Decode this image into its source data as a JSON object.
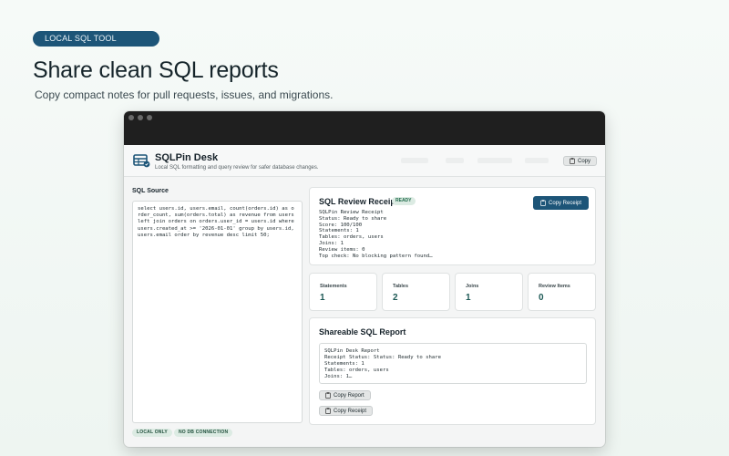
{
  "hero": {
    "tag": "LOCAL SQL TOOL",
    "title": "Share clean SQL reports",
    "subtitle": "Copy compact notes for pull requests, issues, and migrations."
  },
  "app": {
    "name": "SQLPin Desk",
    "tagline": "Local SQL formatting and query review for safer database changes.",
    "copy_label": "Copy"
  },
  "sql_source": {
    "label": "SQL Source",
    "value": "select users.id, users.email, count(orders.id) as order_count, sum(orders.total) as revenue from users left join orders on orders.user_id = users.id where users.created_at >= '2026-01-01' group by users.id, users.email order by revenue desc limit 50;"
  },
  "footer_badges": [
    "LOCAL ONLY",
    "NO DB CONNECTION"
  ],
  "receipt": {
    "title": "SQL Review Receipt",
    "status_badge": "READY",
    "copy_label": "Copy Receipt",
    "lines": [
      "SQLPin Review Receipt",
      "Status: Ready to share",
      "Score: 100/100",
      "Statements: 1",
      "Tables: orders, users",
      "Joins: 1",
      "Review items: 0",
      "Top check: No blocking pattern found…"
    ]
  },
  "stats": [
    {
      "label": "Statements",
      "value": "1"
    },
    {
      "label": "Tables",
      "value": "2"
    },
    {
      "label": "Joins",
      "value": "1"
    },
    {
      "label": "Review Items",
      "value": "0"
    }
  ],
  "report": {
    "title": "Shareable SQL Report",
    "lines": [
      "SQLPin Desk Report",
      "Receipt Status: Status: Ready to share",
      "Statements: 1",
      "Tables: orders, users",
      "Joins: 1…"
    ],
    "copy_report_label": "Copy Report",
    "copy_receipt_label": "Copy Receipt"
  },
  "colors": {
    "accent": "#1d5578",
    "ready_bg": "#dcebe3",
    "stat_value": "#1e5a56"
  },
  "icons": {
    "logo": "table-database-icon",
    "copy": "clipboard-icon"
  }
}
